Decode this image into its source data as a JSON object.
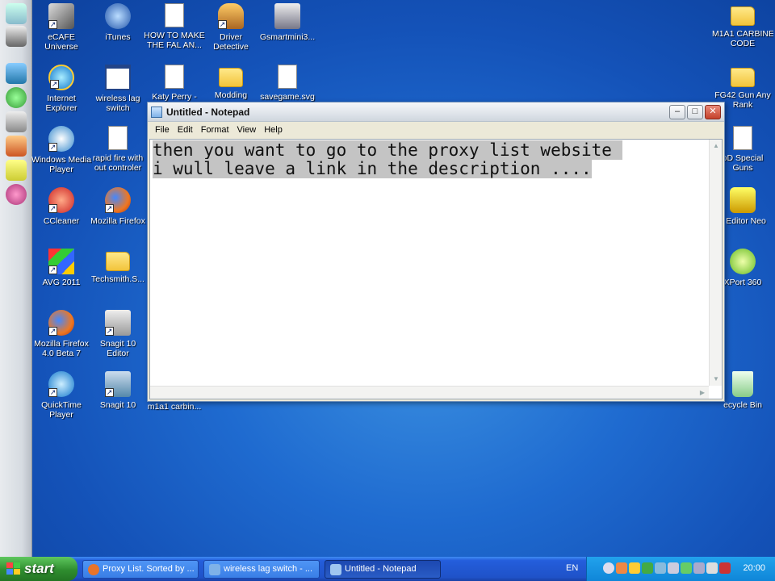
{
  "desktop": {
    "icons": [
      {
        "label": "eCAFE\nUniverse",
        "line1": "eCAFE",
        "line2": "Universe"
      },
      {
        "label": "iTunes",
        "line1": "iTunes",
        "line2": ""
      },
      {
        "line1": "HOW TO MAKE",
        "line2": "THE FAL AN..."
      },
      {
        "line1": "Driver",
        "line2": "Detective"
      },
      {
        "line1": "Gsmartmini3...",
        "line2": ""
      },
      {
        "line1": "M1A1 CARBINE",
        "line2": "CODE"
      },
      {
        "line1": "Internet",
        "line2": "Explorer"
      },
      {
        "line1": "wireless lag",
        "line2": "switch"
      },
      {
        "line1": "Katy Perry -",
        "line2": ""
      },
      {
        "line1": "Modding",
        "line2": ""
      },
      {
        "line1": "savegame.svg",
        "line2": ""
      },
      {
        "line1": "FG42 Gun Any",
        "line2": "Rank"
      },
      {
        "line1": "Windows Media",
        "line2": "Player"
      },
      {
        "line1": "rapid fire with",
        "line2": "out controler"
      },
      {
        "line1": "oD Special",
        "line2": "Guns"
      },
      {
        "line1": "CCleaner",
        "line2": ""
      },
      {
        "line1": "Mozilla Firefox",
        "line2": ""
      },
      {
        "line1": "k Editor Neo",
        "line2": ""
      },
      {
        "line1": "AVG 2011",
        "line2": ""
      },
      {
        "line1": "Techsmith.S...",
        "line2": ""
      },
      {
        "line1": "XPort 360",
        "line2": ""
      },
      {
        "line1": "Mozilla Firefox",
        "line2": "4.0 Beta 7"
      },
      {
        "line1": "Snagit 10",
        "line2": "Editor"
      },
      {
        "line1": "QuickTime",
        "line2": "Player"
      },
      {
        "line1": "Snagit 10",
        "line2": ""
      },
      {
        "line1": "m1a1 carbin...",
        "line2": ""
      },
      {
        "line1": "ecycle Bin",
        "line2": ""
      }
    ]
  },
  "notepad": {
    "title": "Untitled - Notepad",
    "menu": [
      "File",
      "Edit",
      "Format",
      "View",
      "Help"
    ],
    "lines": [
      "then you want to go to the proxy list website ",
      "i wull leave a link in the description ...."
    ],
    "minimize": "–",
    "maximize": "□",
    "close": "✕"
  },
  "taskbar": {
    "start": "start",
    "tasks": [
      {
        "label": "Proxy List. Sorted by ...",
        "icon": "firefox-icon",
        "color": "#e8742a"
      },
      {
        "label": "wireless lag switch - ...",
        "icon": "ie-icon",
        "color": "#7fb2e8"
      },
      {
        "label": "Untitled - Notepad",
        "icon": "notepad-icon",
        "color": "#9fc6f0"
      }
    ],
    "language": "EN",
    "clock": "20:00"
  }
}
